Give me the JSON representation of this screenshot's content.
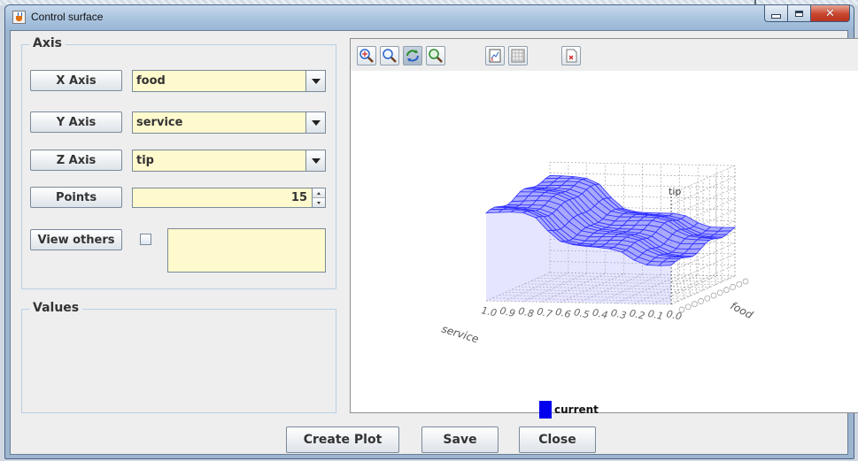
{
  "window": {
    "title": "Control surface"
  },
  "axis_group": {
    "title": "Axis",
    "x_axis": {
      "label": "X Axis",
      "value": "food"
    },
    "y_axis": {
      "label": "Y Axis",
      "value": "service"
    },
    "z_axis": {
      "label": "Z Axis",
      "value": "tip"
    },
    "points": {
      "label": "Points",
      "value": "15"
    },
    "view_others": {
      "label": "View others",
      "checked": false
    }
  },
  "values_group": {
    "title": "Values"
  },
  "plot": {
    "toolbar": [
      "zoom-fit-icon",
      "zoom-icon",
      "rotate-icon",
      "reset-view-icon",
      "export-icon",
      "grid-icon",
      "close-plot-icon"
    ],
    "axis_labels": {
      "x": "food",
      "y": "service",
      "z": "tip"
    },
    "service_ticks": [
      "1.0",
      "0.9",
      "0.8",
      "0.7",
      "0.6",
      "0.5",
      "0.4",
      "0.3",
      "0.2",
      "0.1",
      "0.0"
    ],
    "legend": "current",
    "surface_color": "#3232ff"
  },
  "buttons": {
    "create_plot": "Create Plot",
    "save": "Save",
    "close": "Close"
  }
}
